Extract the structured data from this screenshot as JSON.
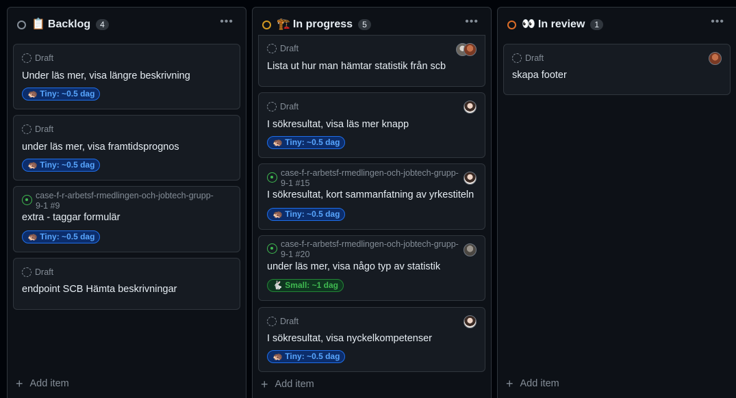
{
  "columns": [
    {
      "title": "Backlog",
      "emoji": "📋",
      "count": "4",
      "status_color": "#848d97",
      "add_item": "Add item",
      "cards": [
        {
          "meta": "Draft",
          "title": "Under läs mer, visa längre beskrivning",
          "label": "🦔 Tiny: ~0.5 dag"
        },
        {
          "meta": "Draft",
          "title": "under läs mer, visa framtidsprognos",
          "label": "🦔 Tiny: ~0.5 dag"
        },
        {
          "meta": "case-f-r-arbetsf-rmedlingen-och-jobtech-grupp-9-1 #9",
          "title": "extra - taggar formulär",
          "label": "🦔 Tiny: ~0.5 dag"
        },
        {
          "meta": "Draft",
          "title": "endpoint SCB Hämta beskrivningar"
        }
      ]
    },
    {
      "title": "In progress",
      "emoji": "🏗️",
      "count": "5",
      "status_color": "#d29922",
      "add_item": "Add item",
      "cards": [
        {
          "meta": "Draft",
          "title": "Lista ut hur man hämtar statistik från scb"
        },
        {
          "meta": "Draft",
          "title": "I sökresultat, visa läs mer knapp",
          "label": "🦔 Tiny: ~0.5 dag"
        },
        {
          "meta": "case-f-r-arbetsf-rmedlingen-och-jobtech-grupp-9-1 #15",
          "title": "I sökresultat, kort sammanfatning av yrkestiteln",
          "label": "🦔 Tiny: ~0.5 dag"
        },
        {
          "meta": "case-f-r-arbetsf-rmedlingen-och-jobtech-grupp-9-1 #20",
          "title": "under läs mer, visa någo typ av statistik",
          "label": "🐇 Small: ~1 dag"
        },
        {
          "meta": "Draft",
          "title": "I sökresultat, visa nyckelkompetenser",
          "label": "🦔 Tiny: ~0.5 dag"
        }
      ]
    },
    {
      "title": "In review",
      "emoji": "👀",
      "count": "1",
      "status_color": "#db6d28",
      "add_item": "Add item",
      "cards": [
        {
          "meta": "Draft",
          "title": "skapa footer"
        }
      ]
    }
  ]
}
